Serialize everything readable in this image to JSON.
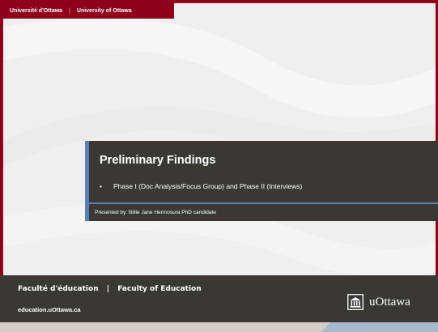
{
  "header": {
    "university_fr": "Université d'Ottawa",
    "separator": "|",
    "university_en": "University of Ottawa"
  },
  "title_slide": {
    "title": "Preliminary Findings",
    "bullet_marker": "•",
    "bullet": "Phase I (Doc Analysis/Focus Group) and Phase II (Interviews)",
    "presenter": "Presented by: Billie Jane Hermosura PhD candidate"
  },
  "footer": {
    "faculty_fr": "Faculté d'éducation",
    "pipe": "|",
    "faculty_en": "Faculty of Education",
    "url": "education.uOttawa.ca",
    "logo_text": "uOttawa",
    "logo_icon": "building-icon"
  },
  "colors": {
    "brand": "#8f001a",
    "accent": "#5b7fb4",
    "dark": "#3b3834"
  }
}
